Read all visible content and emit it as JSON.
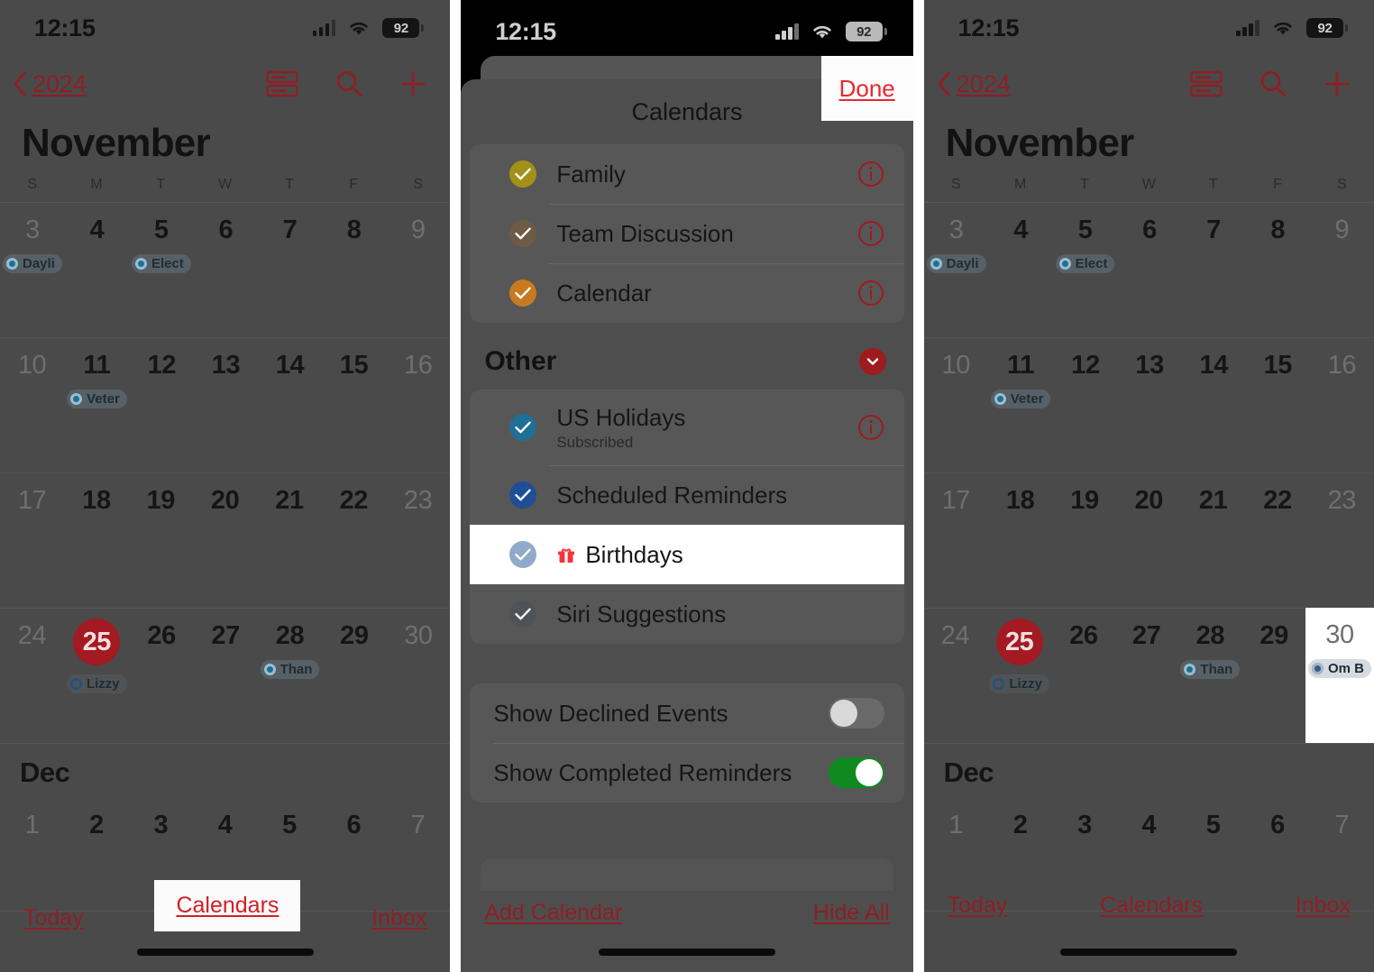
{
  "status_bar": {
    "time": "12:15",
    "battery": "92",
    "signal_icon": "cellular-bars-icon",
    "wifi_icon": "wifi-icon",
    "battery_icon": "battery-icon"
  },
  "calendar_screen": {
    "back_label": "2024",
    "back_icon": "chevron-left-icon",
    "toolbar": {
      "list_view_icon": "list-view-icon",
      "search_icon": "search-icon",
      "add_icon": "plus-icon"
    },
    "month_title": "November",
    "day_headers": [
      "S",
      "M",
      "T",
      "W",
      "T",
      "F",
      "S"
    ],
    "weeks": [
      [
        {
          "num": "3",
          "dim": true,
          "events": [
            {
              "text": "Dayli",
              "style": "filled"
            }
          ]
        },
        {
          "num": "4",
          "dim": false,
          "events": []
        },
        {
          "num": "5",
          "dim": false,
          "events": [
            {
              "text": "Elect",
              "style": "filled"
            }
          ]
        },
        {
          "num": "6",
          "dim": false,
          "events": []
        },
        {
          "num": "7",
          "dim": false,
          "events": []
        },
        {
          "num": "8",
          "dim": false,
          "events": []
        },
        {
          "num": "9",
          "dim": true,
          "events": []
        }
      ],
      [
        {
          "num": "10",
          "dim": true,
          "events": []
        },
        {
          "num": "11",
          "dim": false,
          "events": [
            {
              "text": "Veter",
              "style": "filled"
            }
          ]
        },
        {
          "num": "12",
          "dim": false,
          "events": []
        },
        {
          "num": "13",
          "dim": false,
          "events": []
        },
        {
          "num": "14",
          "dim": false,
          "events": []
        },
        {
          "num": "15",
          "dim": false,
          "events": []
        },
        {
          "num": "16",
          "dim": true,
          "events": []
        }
      ],
      [
        {
          "num": "17",
          "dim": true,
          "events": []
        },
        {
          "num": "18",
          "dim": false,
          "events": []
        },
        {
          "num": "19",
          "dim": false,
          "events": []
        },
        {
          "num": "20",
          "dim": false,
          "events": []
        },
        {
          "num": "21",
          "dim": false,
          "events": []
        },
        {
          "num": "22",
          "dim": false,
          "events": []
        },
        {
          "num": "23",
          "dim": true,
          "events": []
        }
      ],
      [
        {
          "num": "24",
          "dim": true,
          "events": []
        },
        {
          "num": "25",
          "dim": false,
          "today": true,
          "events": [
            {
              "text": "Lizzy",
              "style": "hollow"
            }
          ]
        },
        {
          "num": "26",
          "dim": false,
          "events": []
        },
        {
          "num": "27",
          "dim": false,
          "events": []
        },
        {
          "num": "28",
          "dim": false,
          "events": [
            {
              "text": "Than",
              "style": "filled"
            }
          ]
        },
        {
          "num": "29",
          "dim": false,
          "events": []
        },
        {
          "num": "30",
          "dim": true,
          "events": []
        }
      ]
    ],
    "next_month_label": "Dec",
    "dec_week": [
      {
        "num": "1",
        "dim": true
      },
      {
        "num": "2",
        "dim": false
      },
      {
        "num": "3",
        "dim": false
      },
      {
        "num": "4",
        "dim": false
      },
      {
        "num": "5",
        "dim": false
      },
      {
        "num": "6",
        "dim": false
      },
      {
        "num": "7",
        "dim": true
      }
    ],
    "tabs": {
      "today": "Today",
      "calendars": "Calendars",
      "inbox": "Inbox"
    }
  },
  "panel3": {
    "highlighted_day": {
      "num": "30",
      "event": "Om B"
    }
  },
  "calendars_sheet": {
    "title": "Calendars",
    "done_label": "Done",
    "group_main": [
      {
        "name": "Family",
        "color": "#a39117",
        "checked": true,
        "has_info": true,
        "info_icon": "info-circle-icon"
      },
      {
        "name": "Team Discussion",
        "color": "#6d5b45",
        "checked": true,
        "has_info": true,
        "info_icon": "info-circle-icon"
      },
      {
        "name": "Calendar",
        "color": "#c77a21",
        "checked": true,
        "has_info": true,
        "info_icon": "info-circle-icon"
      }
    ],
    "other_section": {
      "title": "Other",
      "collapse_icon": "chevron-down-circle-icon",
      "items": [
        {
          "name": "US Holidays",
          "subtitle": "Subscribed",
          "color": "#1f6f96",
          "checked": true,
          "has_info": true,
          "info_icon": "info-circle-icon",
          "highlighted": false,
          "leading_icon": null
        },
        {
          "name": "Scheduled Reminders",
          "subtitle": "",
          "color": "#1f4e96",
          "checked": true,
          "has_info": false,
          "info_icon": null,
          "highlighted": false,
          "leading_icon": null
        },
        {
          "name": "Birthdays",
          "subtitle": "",
          "color": "#8fabc9",
          "checked": true,
          "has_info": false,
          "info_icon": null,
          "highlighted": true,
          "leading_icon": "gift-icon"
        },
        {
          "name": "Siri Suggestions",
          "subtitle": "",
          "color": "#4f5358",
          "checked": true,
          "has_info": false,
          "info_icon": null,
          "highlighted": false,
          "leading_icon": null
        }
      ]
    },
    "toggles": [
      {
        "label": "Show Declined Events",
        "on": false
      },
      {
        "label": "Show Completed Reminders",
        "on": true
      }
    ],
    "footer": {
      "add_calendar": "Add Calendar",
      "hide_all": "Hide All"
    }
  },
  "colors": {
    "accent_red": "#cf2027",
    "dim_red": "#8e1f24",
    "today_red": "#a31a22",
    "toggle_green": "#0f8a21",
    "highlight_white": "#ffffff"
  }
}
